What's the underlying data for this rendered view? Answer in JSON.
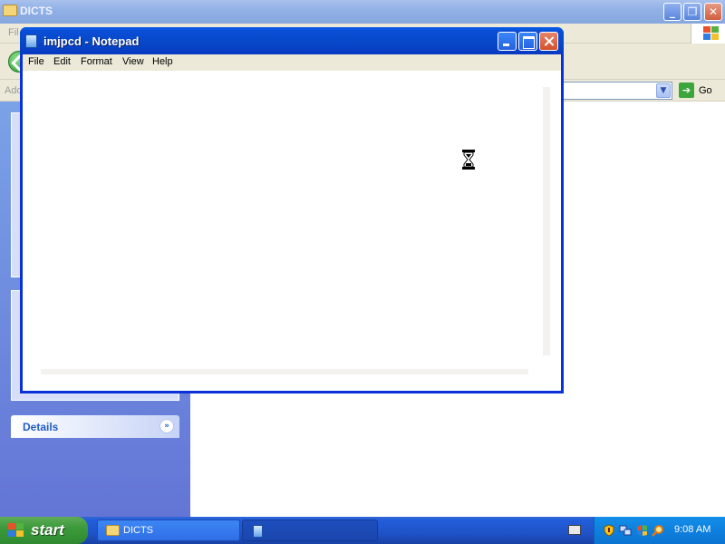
{
  "explorer": {
    "title": "DICTS",
    "menu_file": "Fil",
    "address_label": "Add",
    "go_label": "Go",
    "sidebar": {
      "details_label": "Details"
    }
  },
  "notepad": {
    "title": "imjpcd - Notepad",
    "menu": [
      "File",
      "Edit",
      "Format",
      "View",
      "Help"
    ],
    "content": ""
  },
  "taskbar": {
    "start_label": "start",
    "tasks": [
      {
        "label": "DICTS",
        "icon": "folder-icon"
      },
      {
        "label": "",
        "icon": "notepad-icon"
      }
    ],
    "clock": "9:08 AM",
    "tray_icons": [
      "security-shield-icon",
      "network-icon",
      "windows-update-icon",
      "search-icon"
    ]
  },
  "colors": {
    "xp_blue": "#0831d9",
    "start_green": "#3c9a3c",
    "tray_blue": "#0f82e0"
  }
}
